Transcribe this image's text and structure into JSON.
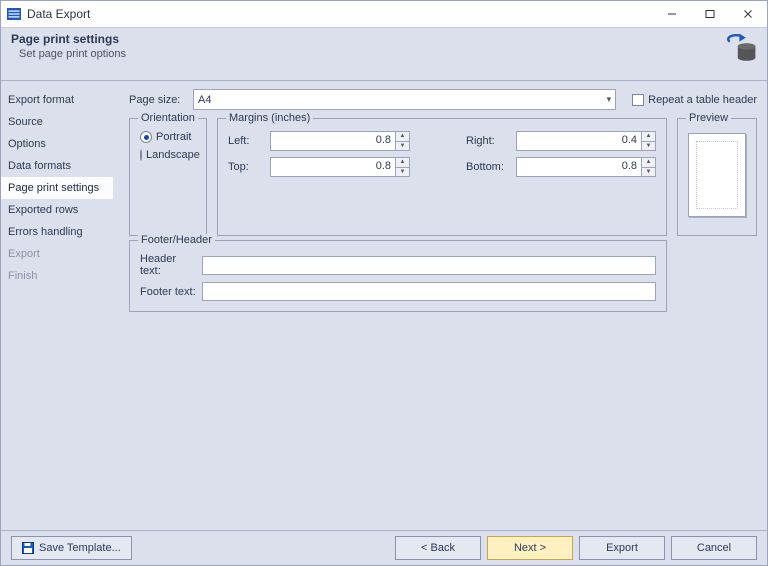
{
  "window": {
    "title": "Data Export"
  },
  "banner": {
    "heading": "Page print settings",
    "sub": "Set page print options"
  },
  "sidebar": {
    "items": [
      {
        "label": "Export format"
      },
      {
        "label": "Source"
      },
      {
        "label": "Options"
      },
      {
        "label": "Data formats"
      },
      {
        "label": "Page print settings"
      },
      {
        "label": "Exported rows"
      },
      {
        "label": "Errors handling"
      },
      {
        "label": "Export"
      },
      {
        "label": "Finish"
      }
    ]
  },
  "content": {
    "pagesize_label": "Page size:",
    "pagesize_value": "A4",
    "repeat_header_label": "Repeat a table header",
    "orientation_legend": "Orientation",
    "portrait_label": "Portrait",
    "landscape_label": "Landscape",
    "margins_legend": "Margins (inches)",
    "left_label": "Left:",
    "left_value": "0.8",
    "right_label": "Right:",
    "right_value": "0.4",
    "top_label": "Top:",
    "top_value": "0.8",
    "bottom_label": "Bottom:",
    "bottom_value": "0.8",
    "footerheader_legend": "Footer/Header",
    "header_text_label": "Header text:",
    "header_text_value": "",
    "footer_text_label": "Footer text:",
    "footer_text_value": "",
    "preview_legend": "Preview"
  },
  "buttons": {
    "save_template": "Save Template...",
    "back": "< Back",
    "next": "Next >",
    "export": "Export",
    "cancel": "Cancel"
  }
}
